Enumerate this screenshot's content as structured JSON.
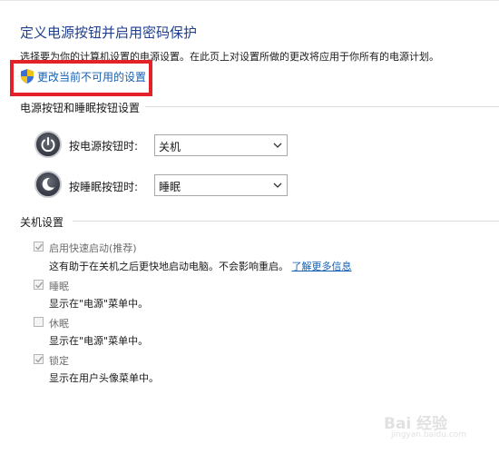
{
  "header": {
    "title": "定义电源按钮并启用密码保护",
    "subtitle": "选择要为你的计算机设置的电源设置。在此页上对设置所做的更改将应用于你所有的电源计划。"
  },
  "change_settings_link": "更改当前不可用的设置",
  "power_buttons_section": {
    "title": "电源按钮和睡眠按钮设置",
    "power_button": {
      "label": "按电源按钮时:",
      "value": "关机"
    },
    "sleep_button": {
      "label": "按睡眠按钮时:",
      "value": "睡眠"
    }
  },
  "shutdown_section": {
    "title": "关机设置",
    "options": [
      {
        "label": "启用快速启动(推荐)",
        "checked": true,
        "description": "这有助于在关机之后更快地启动电脑。不会影响重启。",
        "link": "了解更多信息"
      },
      {
        "label": "睡眠",
        "checked": true,
        "description": "显示在\"电源\"菜单中。"
      },
      {
        "label": "休眠",
        "checked": false,
        "description": "显示在\"电源\"菜单中。"
      },
      {
        "label": "锁定",
        "checked": true,
        "description": "显示在用户头像菜单中。"
      }
    ]
  },
  "watermark": {
    "text": "Bai 经验",
    "sub": "jingyan.baidu.com"
  },
  "colors": {
    "title": "#1f3f8f",
    "link": "#1560b5",
    "highlight_border": "#e32128"
  },
  "icons": [
    "shield-icon",
    "power-button-icon",
    "sleep-button-icon",
    "chevron-down-icon",
    "checkmark-icon"
  ]
}
